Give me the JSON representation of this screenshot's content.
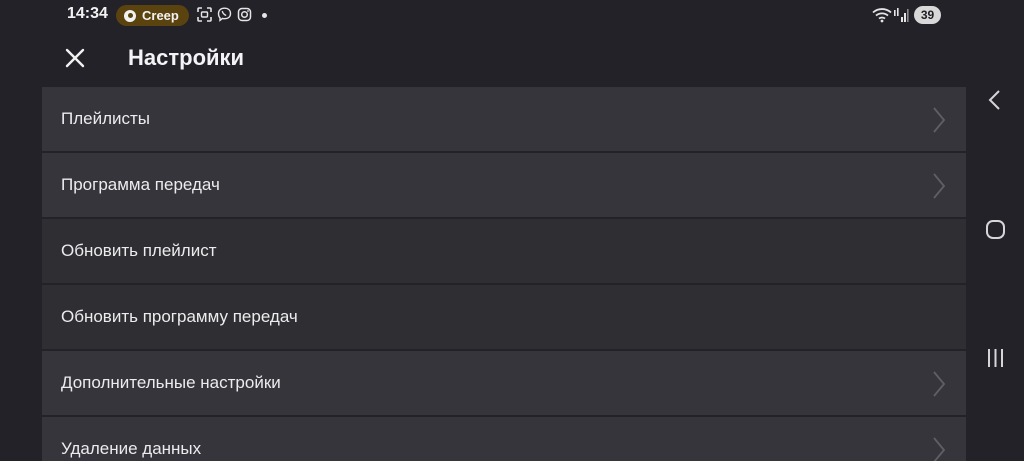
{
  "status_bar": {
    "time": "14:34",
    "pill_label": "Creep",
    "battery": "39",
    "icons": [
      "screenshot-icon",
      "viber-icon",
      "instagram-icon",
      "notification-dot-icon",
      "wifi-icon",
      "signal-icon"
    ]
  },
  "header": {
    "title": "Настройки",
    "close_icon": "close-icon"
  },
  "settings": {
    "items": [
      {
        "label": "Плейлисты",
        "has_chevron": true
      },
      {
        "label": "Программа передач",
        "has_chevron": true
      },
      {
        "label": "Обновить плейлист",
        "has_chevron": false
      },
      {
        "label": "Обновить программу передач",
        "has_chevron": false
      },
      {
        "label": "Дополнительные настройки",
        "has_chevron": true
      },
      {
        "label": "Удаление данных",
        "has_chevron": true
      }
    ]
  },
  "nav_bar": {
    "icons": [
      "back-icon",
      "home-icon",
      "recent-apps-icon"
    ]
  },
  "colors": {
    "background": "#232228",
    "row_with_chevron": "#36353c",
    "row_plain": "#2f2f33",
    "pill": "#5b4310",
    "text": "#ececee"
  }
}
